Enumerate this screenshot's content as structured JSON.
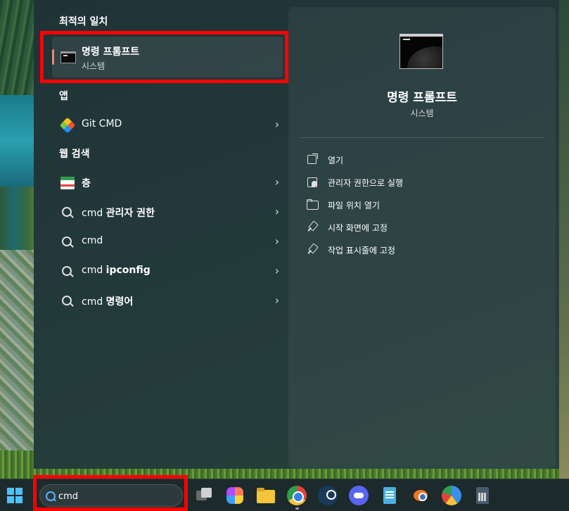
{
  "left": {
    "best_match_title": "최적의 일치",
    "best_match": {
      "title": "명령 프롬프트",
      "subtitle": "시스템"
    },
    "apps_title": "앱",
    "apps": [
      {
        "label": "Git CMD",
        "icon": "git-icon"
      }
    ],
    "web_title": "웹 검색",
    "web_results": [
      {
        "prefix": "",
        "bold": "층",
        "icon": "calendar-icon"
      },
      {
        "prefix": "cmd ",
        "bold": "관리자 권한",
        "icon": "search-icon"
      },
      {
        "prefix": "cmd",
        "bold": "",
        "icon": "search-icon"
      },
      {
        "prefix": "cmd ",
        "bold": "ipconfig",
        "icon": "search-icon"
      },
      {
        "prefix": "cmd ",
        "bold": "명령어",
        "icon": "search-icon"
      }
    ]
  },
  "right": {
    "title": "명령 프롬프트",
    "subtitle": "시스템",
    "actions": [
      {
        "label": "열기",
        "icon": "open-icon"
      },
      {
        "label": "관리자 권한으로 실행",
        "icon": "admin-icon"
      },
      {
        "label": "파일 위치 열기",
        "icon": "folder-icon"
      },
      {
        "label": "시작 화면에 고정",
        "icon": "pin-icon"
      },
      {
        "label": "작업 표시줄에 고정",
        "icon": "pin-icon"
      }
    ]
  },
  "taskbar": {
    "search_value": "cmd",
    "icons": [
      "windows-start-icon",
      "task-view-icon",
      "copilot-icon",
      "file-explorer-icon",
      "chrome-icon",
      "steam-icon",
      "discord-icon",
      "notepad-icon",
      "blender-icon",
      "paint-icon",
      "calculator-icon"
    ]
  },
  "colors": {
    "highlight": "#ff0000",
    "accent": "#e88a6e",
    "panel": "#22383a"
  }
}
